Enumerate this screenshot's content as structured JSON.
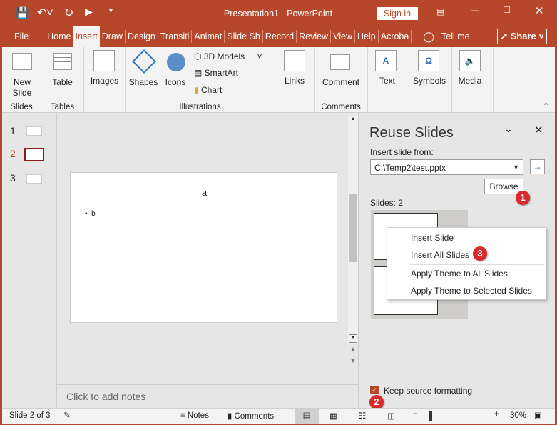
{
  "title_bar": {
    "title": "Presentation1  -  PowerPoint",
    "sign_in": "Sign in"
  },
  "tabs": [
    "File",
    "Home",
    "Insert",
    "Draw",
    "Design",
    "Transiti",
    "Animat",
    "Slide Sh",
    "Record",
    "Review",
    "View",
    "Help",
    "Acroba"
  ],
  "tell_me": "Tell me",
  "share": "Share",
  "ribbon": {
    "new_slide": "New Slide",
    "slides_group": "Slides",
    "table": "Table",
    "tables_group": "Tables",
    "images": "Images",
    "shapes": "Shapes",
    "icons": "Icons",
    "models": "3D Models",
    "smartart": "SmartArt",
    "chart": "Chart",
    "illustrations_group": "Illustrations",
    "links": "Links",
    "comment": "Comment",
    "comments_group": "Comments",
    "text": "Text",
    "symbols": "Symbols",
    "media": "Media"
  },
  "thumbnails": [
    "1",
    "2",
    "3"
  ],
  "slide": {
    "title": "a",
    "bullet": "b"
  },
  "notes_placeholder": "Click to add notes",
  "pane": {
    "title": "Reuse Slides",
    "insert_from_label": "Insert slide from:",
    "path": "C:\\Temp2\\test.pptx",
    "browse": "Browse",
    "slides_count": "Slides: 2",
    "keep_source": "Keep source formatting",
    "keep_source_checked": true
  },
  "context_menu": [
    "Insert Slide",
    "Insert All Slides",
    "Apply Theme to All Slides",
    "Apply Theme to Selected Slides"
  ],
  "badges": [
    "1",
    "2",
    "3"
  ],
  "status": {
    "slide_info": "Slide 2 of 3",
    "notes": "Notes",
    "comments": "Comments",
    "zoom": "30%",
    "zoom_level_percent": 30
  },
  "colors": {
    "accent": "#b7472a",
    "badge": "#d92b2b"
  }
}
